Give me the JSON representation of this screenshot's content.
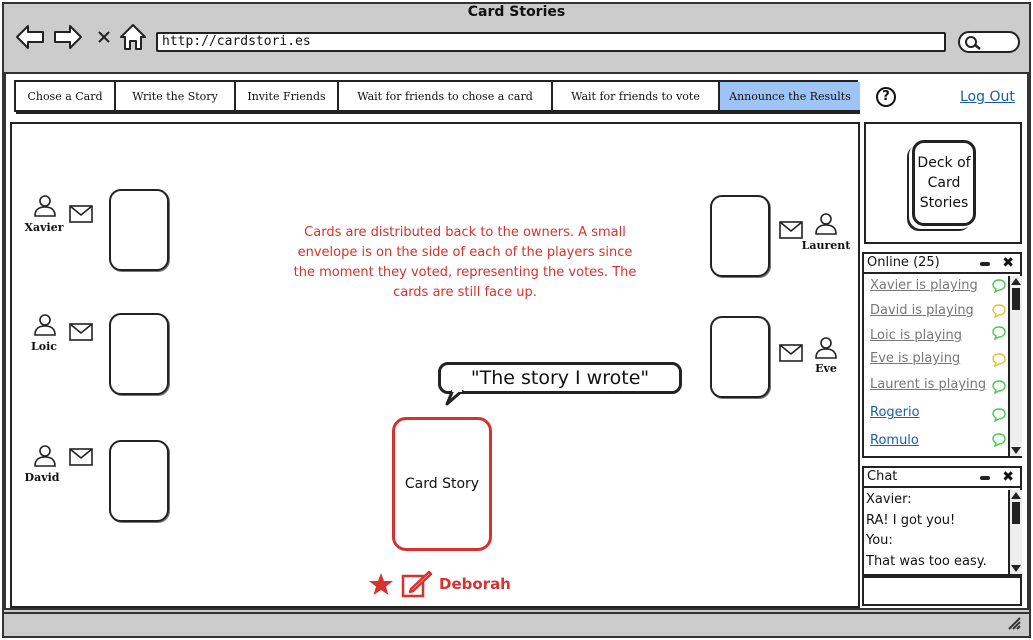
{
  "window": {
    "title": "Card Stories",
    "url": "http://cardstori.es"
  },
  "icons": {
    "back": "arrow-left-icon",
    "forward": "arrow-right-icon",
    "stop": "close-icon",
    "home": "home-icon",
    "search": "search-icon",
    "help": "help-icon",
    "person": "person-icon",
    "envelope": "envelope-icon",
    "star": "star-icon",
    "edit": "edit-icon",
    "chat": "speech-bubble-icon"
  },
  "colors": {
    "accent": "#9ec4f5",
    "note": "#d7322e",
    "link": "#1a5ea8"
  },
  "steps": [
    {
      "label": "Chose a Card",
      "active": false
    },
    {
      "label": "Write the Story",
      "active": false
    },
    {
      "label": "Invite Friends",
      "active": false
    },
    {
      "label": "Wait for friends to chose a card",
      "active": false
    },
    {
      "label": "Wait for friends to vote",
      "active": false
    },
    {
      "label": "Announce the Results",
      "active": true
    }
  ],
  "header": {
    "help": "?",
    "logout": "Log Out"
  },
  "board": {
    "players": [
      "Xavier",
      "Loic",
      "David",
      "Laurent",
      "Eve"
    ],
    "note": "Cards are distributed back to the owners. A small envelope is on the side of each of the players since the moment they voted, representing the votes. The cards are still face up.",
    "story_quote": "\"The story I wrote\"",
    "story_card": "Card Story",
    "storyteller": "Deborah"
  },
  "deck": {
    "label_line1": "Deck of",
    "label_line2": "Card",
    "label_line3": "Stories"
  },
  "online": {
    "title": "Online (25)",
    "items": [
      {
        "label": "Xavier is playing",
        "status": "green"
      },
      {
        "label": "David is playing",
        "status": "yellow"
      },
      {
        "label": "Loic is playing",
        "status": "green"
      },
      {
        "label": "Eve is playing",
        "status": "yellow"
      },
      {
        "label": "Laurent is playing",
        "status": "green"
      },
      {
        "label": "Rogerio",
        "status": "green"
      },
      {
        "label": "Romulo",
        "status": "green"
      }
    ]
  },
  "chat": {
    "title": "Chat",
    "lines": [
      "Xavier:",
      "RA! I got you!",
      "You:",
      "That was too easy."
    ]
  }
}
